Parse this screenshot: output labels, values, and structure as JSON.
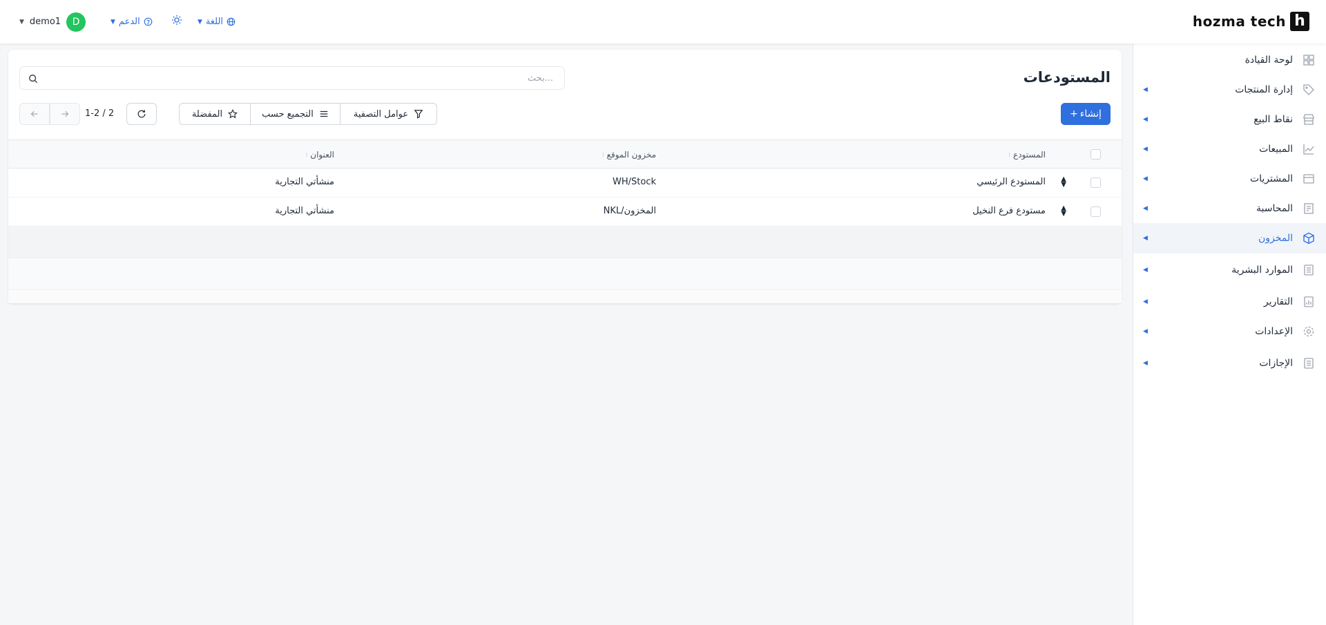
{
  "brand": {
    "mark": "h",
    "name": "hozma tech"
  },
  "topbar": {
    "user": "demo1",
    "avatar_letter": "D",
    "support_label": "الدعم",
    "language_label": "اللغة"
  },
  "sidebar": {
    "items": [
      {
        "label": "لوحة القيادة",
        "icon": "dashboard-icon"
      },
      {
        "label": "إدارة المنتجات",
        "icon": "tag-icon"
      },
      {
        "label": "نقاط البيع",
        "icon": "store-icon"
      },
      {
        "label": "المبيعات",
        "icon": "chart-line-icon"
      },
      {
        "label": "المشتريات",
        "icon": "purchases-icon"
      },
      {
        "label": "المحاسبة",
        "icon": "accounting-icon"
      },
      {
        "label": "المخزون",
        "icon": "box-icon"
      },
      {
        "label": "الموارد البشرية",
        "icon": "hr-icon"
      },
      {
        "label": "التقارير",
        "icon": "reports-icon"
      },
      {
        "label": "الإعدادات",
        "icon": "gear-icon"
      },
      {
        "label": "الإجازات",
        "icon": "leaves-icon"
      }
    ],
    "active": "المخزون"
  },
  "page": {
    "title": "المستودعات",
    "search_placeholder": "بحث...",
    "create_label": "إنشاء",
    "filters_label": "عوامل التصفية",
    "group_by_label": "التجميع حسب",
    "favorites_label": "المفضلة",
    "pager": "1-2 / 2"
  },
  "table": {
    "columns": [
      "المستودع",
      "مخزون الموقع",
      "العنوان"
    ],
    "rows": [
      {
        "warehouse": "المستودع الرئيسي",
        "location": "WH/Stock",
        "address": "منشأتي التجارية"
      },
      {
        "warehouse": "مستودع فرع النخيل",
        "location": "NKL/المخزون",
        "address": "منشأتي التجارية"
      }
    ]
  },
  "colors": {
    "accent": "#2f6fde",
    "avatar": "#22c55e"
  }
}
